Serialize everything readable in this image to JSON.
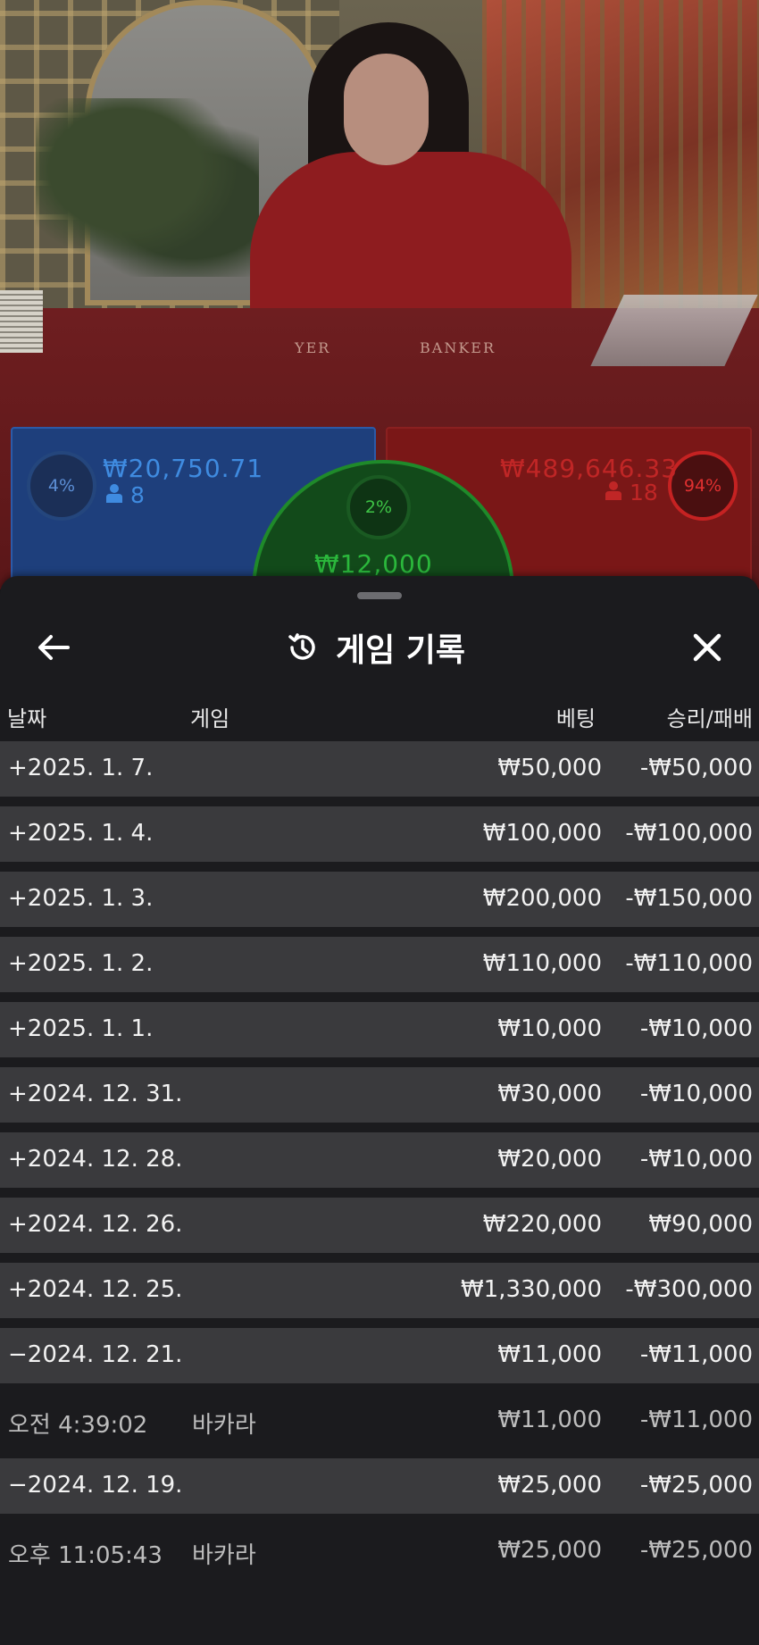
{
  "game": {
    "table_player_label": "YER",
    "table_banker_label": "BANKER",
    "player": {
      "percent": "4%",
      "amount": "₩20,750.71",
      "players": "8"
    },
    "tie": {
      "percent": "2%",
      "amount": "₩12,000"
    },
    "banker": {
      "percent": "94%",
      "amount": "₩489,646.33",
      "players": "18"
    }
  },
  "history": {
    "title": "게임 기록",
    "columns": {
      "date": "날짜",
      "game": "게임",
      "bet": "베팅",
      "winloss": "승리/패배"
    },
    "rows": [
      {
        "type": "date",
        "date": "+2025. 1. 7.",
        "game": "",
        "bet": "₩50,000",
        "winloss": "-₩50,000"
      },
      {
        "type": "date",
        "date": "+2025. 1. 4.",
        "game": "",
        "bet": "₩100,000",
        "winloss": "-₩100,000"
      },
      {
        "type": "date",
        "date": "+2025. 1. 3.",
        "game": "",
        "bet": "₩200,000",
        "winloss": "-₩150,000"
      },
      {
        "type": "date",
        "date": "+2025. 1. 2.",
        "game": "",
        "bet": "₩110,000",
        "winloss": "-₩110,000"
      },
      {
        "type": "date",
        "date": "+2025. 1. 1.",
        "game": "",
        "bet": "₩10,000",
        "winloss": "-₩10,000"
      },
      {
        "type": "date",
        "date": "+2024. 12. 31.",
        "game": "",
        "bet": "₩30,000",
        "winloss": "-₩10,000"
      },
      {
        "type": "date",
        "date": "+2024. 12. 28.",
        "game": "",
        "bet": "₩20,000",
        "winloss": "-₩10,000"
      },
      {
        "type": "date",
        "date": "+2024. 12. 26.",
        "game": "",
        "bet": "₩220,000",
        "winloss": "₩90,000"
      },
      {
        "type": "date",
        "date": "+2024. 12. 25.",
        "game": "",
        "bet": "₩1,330,000",
        "winloss": "-₩300,000"
      },
      {
        "type": "date",
        "date": "−2024. 12. 21.",
        "game": "",
        "bet": "₩11,000",
        "winloss": "-₩11,000"
      },
      {
        "type": "detail",
        "date": "오전 4:39:02",
        "game": "바카라",
        "bet": "₩11,000",
        "winloss": "-₩11,000"
      },
      {
        "type": "date",
        "date": "−2024. 12. 19.",
        "game": "",
        "bet": "₩25,000",
        "winloss": "-₩25,000"
      },
      {
        "type": "detail",
        "date": "오후 11:05:43",
        "game": "바카라",
        "bet": "₩25,000",
        "winloss": "-₩25,000"
      }
    ]
  },
  "icons": {
    "back": "arrow-left-icon",
    "history": "history-icon",
    "close": "close-icon",
    "person": "person-icon"
  }
}
